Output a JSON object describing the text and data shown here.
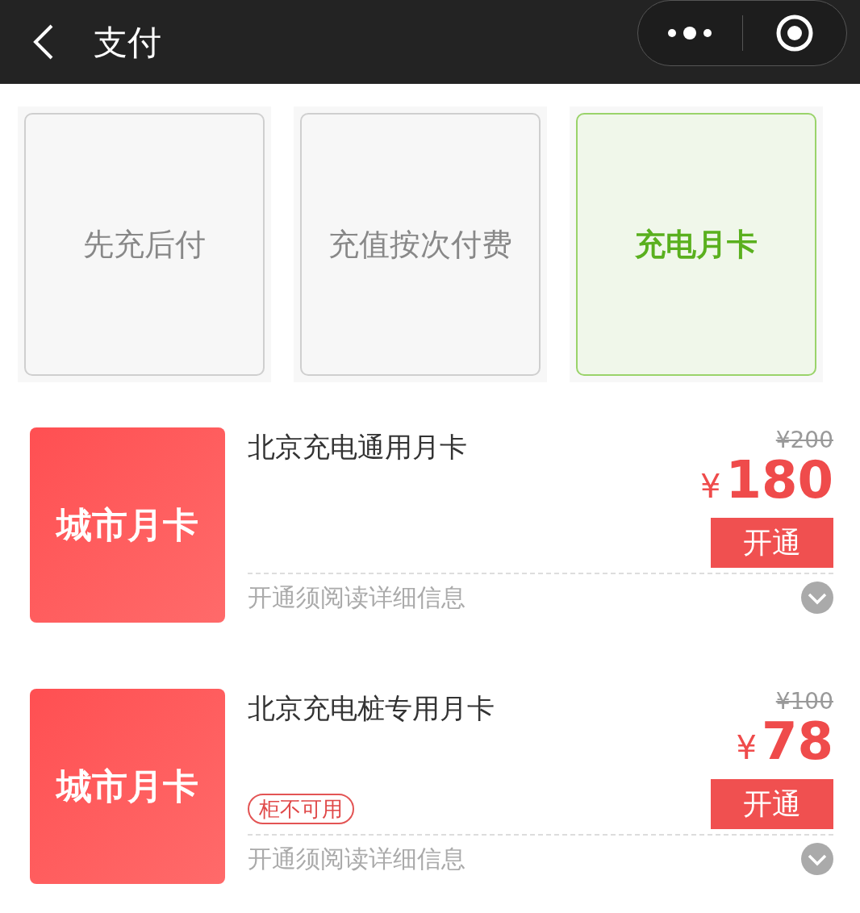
{
  "header": {
    "title": "支付"
  },
  "tabs": [
    {
      "label": "先充后付",
      "selected": false
    },
    {
      "label": "充值按次付费",
      "selected": false
    },
    {
      "label": "充电月卡",
      "selected": true
    }
  ],
  "products": [
    {
      "cover_text": "城市月卡",
      "name": "北京充电通用月卡",
      "old_price": "¥200",
      "currency": "¥",
      "price": "180",
      "button": "开通",
      "details": "开通须阅读详细信息"
    },
    {
      "cover_text": "城市月卡",
      "name": "北京充电桩专用月卡",
      "tag": "柜不可用",
      "old_price": "¥100",
      "currency": "¥",
      "price": "78",
      "button": "开通",
      "details": "开通须阅读详细信息"
    }
  ]
}
